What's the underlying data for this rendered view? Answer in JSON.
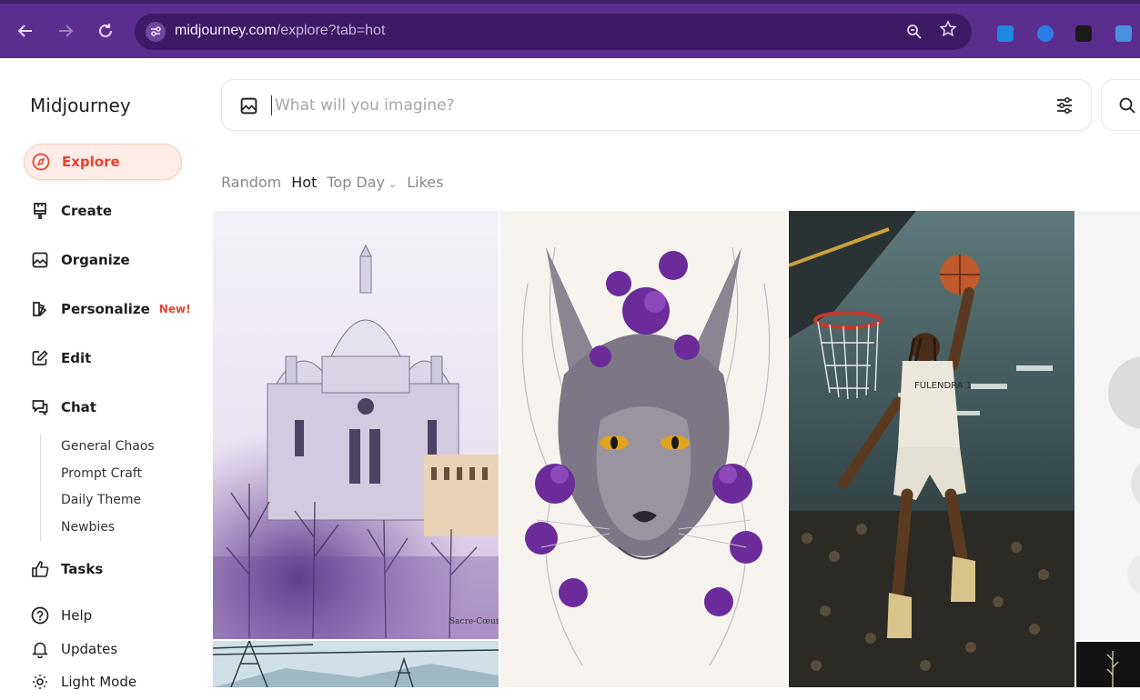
{
  "browser": {
    "url_domain": "midjourney.com",
    "url_path": "/explore?tab=hot"
  },
  "sidebar": {
    "brand": "Midjourney",
    "items": [
      {
        "label": "Explore",
        "icon": "compass-icon"
      },
      {
        "label": "Create",
        "icon": "brush-icon"
      },
      {
        "label": "Organize",
        "icon": "image-icon"
      },
      {
        "label": "Personalize",
        "icon": "palette-icon",
        "badge": "New!"
      },
      {
        "label": "Edit",
        "icon": "edit-icon"
      },
      {
        "label": "Chat",
        "icon": "chat-icon"
      }
    ],
    "chat_rooms": [
      "General Chaos",
      "Prompt Craft",
      "Daily Theme",
      "Newbies"
    ],
    "bottom_items": [
      {
        "label": "Tasks",
        "icon": "thumbs-up-icon"
      },
      {
        "label": "Help",
        "icon": "help-icon"
      },
      {
        "label": "Updates",
        "icon": "bell-icon"
      },
      {
        "label": "Light Mode",
        "icon": "sun-icon"
      }
    ]
  },
  "search": {
    "placeholder": "What will you imagine?"
  },
  "tabs": [
    {
      "label": "Random"
    },
    {
      "label": "Hot"
    },
    {
      "label": "Top Day"
    },
    {
      "label": "Likes"
    }
  ],
  "gallery": [
    {
      "name": "sacre-coeur-watercolor",
      "signature": "Sacre-Cœur"
    },
    {
      "name": "purple-wolf-illustration"
    },
    {
      "name": "basketball-dunk-photo",
      "jersey": "FULENDRA 1"
    },
    {
      "name": "abstract-white-spheres"
    },
    {
      "name": "power-lines-landscape"
    },
    {
      "name": "dark-floral-tile"
    }
  ],
  "colors": {
    "browser_bar": "#5b2d8e",
    "accent": "#e8432e",
    "active_bg": "#fdece8"
  }
}
